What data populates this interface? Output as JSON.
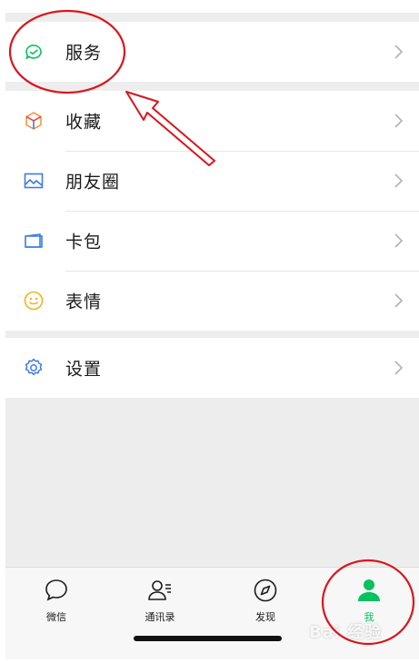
{
  "menu": {
    "groups": [
      {
        "items": [
          {
            "label": "服务",
            "icon": "wechat-pay-icon"
          }
        ]
      },
      {
        "items": [
          {
            "label": "收藏",
            "icon": "cube-icon"
          },
          {
            "label": "朋友圈",
            "icon": "image-icon"
          },
          {
            "label": "卡包",
            "icon": "card-icon"
          },
          {
            "label": "表情",
            "icon": "smiley-icon"
          }
        ]
      },
      {
        "items": [
          {
            "label": "设置",
            "icon": "gear-icon"
          }
        ]
      }
    ]
  },
  "tabbar": {
    "tabs": [
      {
        "label": "微信",
        "icon": "chat-bubble-icon",
        "active": false
      },
      {
        "label": "通讯录",
        "icon": "contacts-icon",
        "active": false
      },
      {
        "label": "发现",
        "icon": "compass-icon",
        "active": false
      },
      {
        "label": "我",
        "icon": "person-icon",
        "active": true
      }
    ]
  },
  "colors": {
    "accent": "#07c160",
    "annotation": "#d9151d",
    "background": "#ededed"
  },
  "watermark": "Bai 经验"
}
